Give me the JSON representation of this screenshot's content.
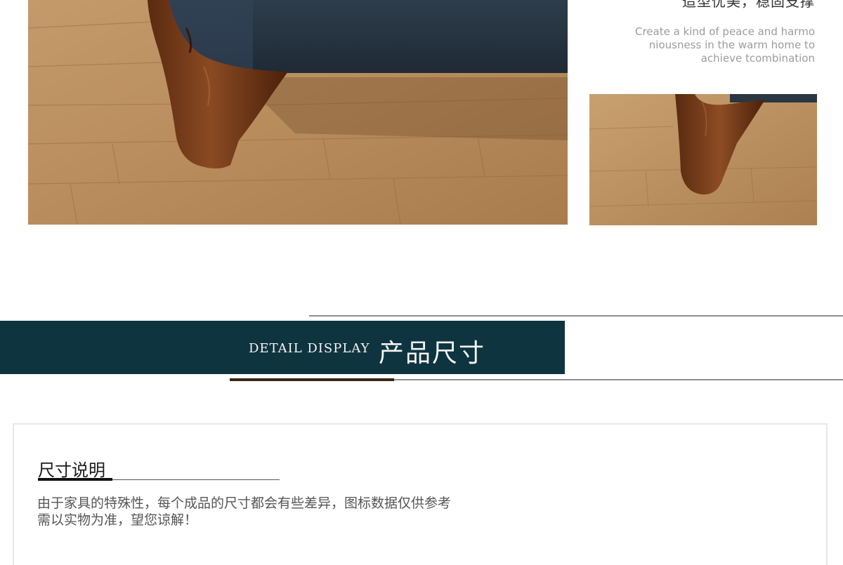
{
  "gallery": {
    "main_photo_icon": "sofa-leg-photo",
    "top_caption_cn": "造型优美，稳固支撑",
    "caption_en_lines": [
      "Create a kind of peace and harmo",
      "niousness in the warm home to",
      "achieve tcombination"
    ],
    "thumb_photo_icon": "sofa-leg-closeup-photo"
  },
  "section": {
    "label_en": "DETAIL DISPLAY",
    "label_cn": "产品尺寸",
    "colors": {
      "banner": "#0e3440",
      "accent": "#3c2415",
      "rule": "#8e8e8e"
    }
  },
  "size_note": {
    "title": "尺寸说明",
    "lines": [
      "由于家具的特殊性，每个成品的尺寸都会有些差异，图标数据仅供参考",
      "需以实物为准，望您谅解！"
    ]
  }
}
